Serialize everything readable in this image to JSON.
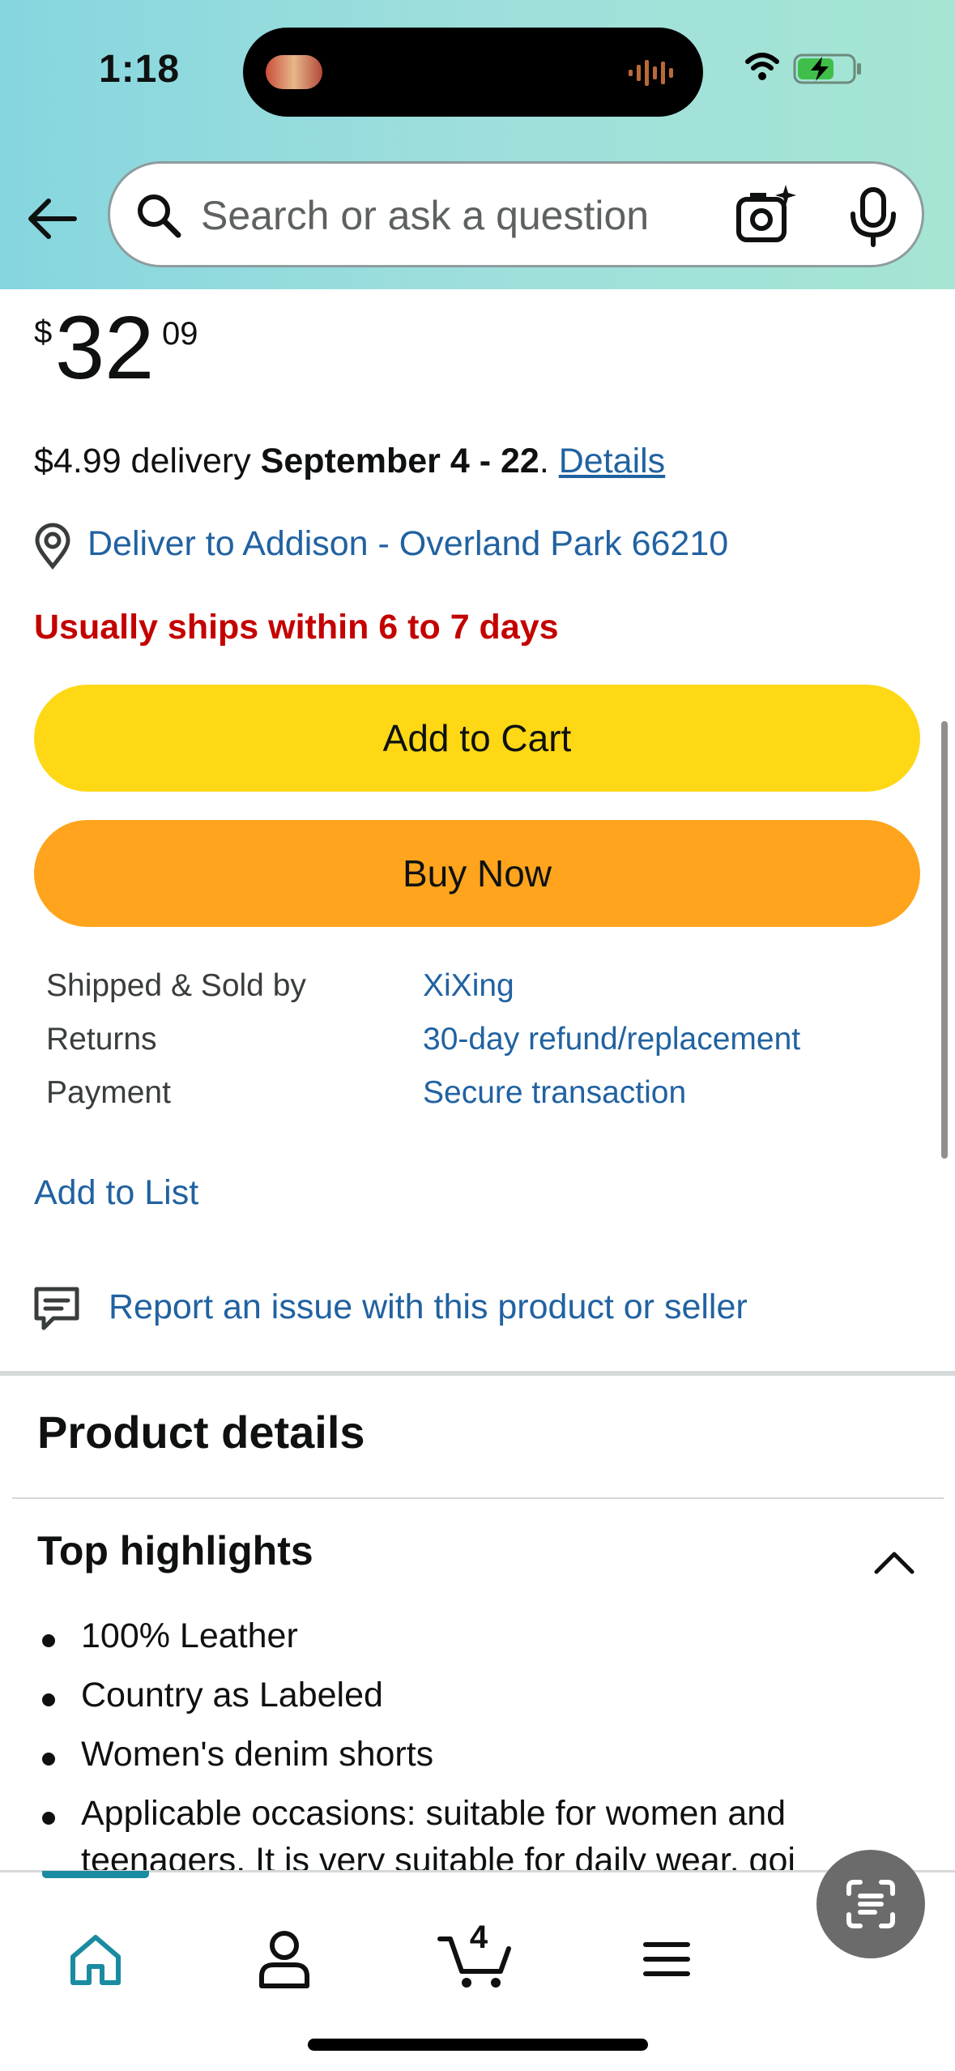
{
  "status_bar": {
    "time": "1:18"
  },
  "search": {
    "placeholder": "Search or ask a question"
  },
  "price": {
    "symbol": "$",
    "whole": "32",
    "fraction": "09"
  },
  "delivery": {
    "fee_prefix": "$4.99 delivery ",
    "dates": "September 4 - 22",
    "separator": ". ",
    "details_link": "Details"
  },
  "deliver_to": "Deliver to Addison - Overland Park 66210",
  "ships_notice": "Usually ships within 6 to 7 days",
  "buttons": {
    "add_to_cart": "Add to Cart",
    "buy_now": "Buy Now"
  },
  "info": [
    {
      "label": "Shipped & Sold by",
      "value": "XiXing"
    },
    {
      "label": "Returns",
      "value": "30-day refund/replacement"
    },
    {
      "label": "Payment",
      "value": "Secure transaction"
    }
  ],
  "add_to_list": "Add to List",
  "report_issue": "Report an issue with this product or seller",
  "product_details": {
    "title": "Product details",
    "top_highlights_title": "Top highlights",
    "highlights": [
      "100% Leather",
      "Country as Labeled",
      "Women's denim shorts",
      "Applicable occasions: suitable for women and",
      "teenagers. It is very suitable for daily wear, goi"
    ]
  },
  "bottom_nav": {
    "cart_count": "4",
    "active_tab": "home",
    "accent_color": "#1a8ba0"
  },
  "colors": {
    "add_to_cart": "#fed815",
    "buy_now": "#ffa41c",
    "link": "#2162a1",
    "warning": "#c40000"
  }
}
